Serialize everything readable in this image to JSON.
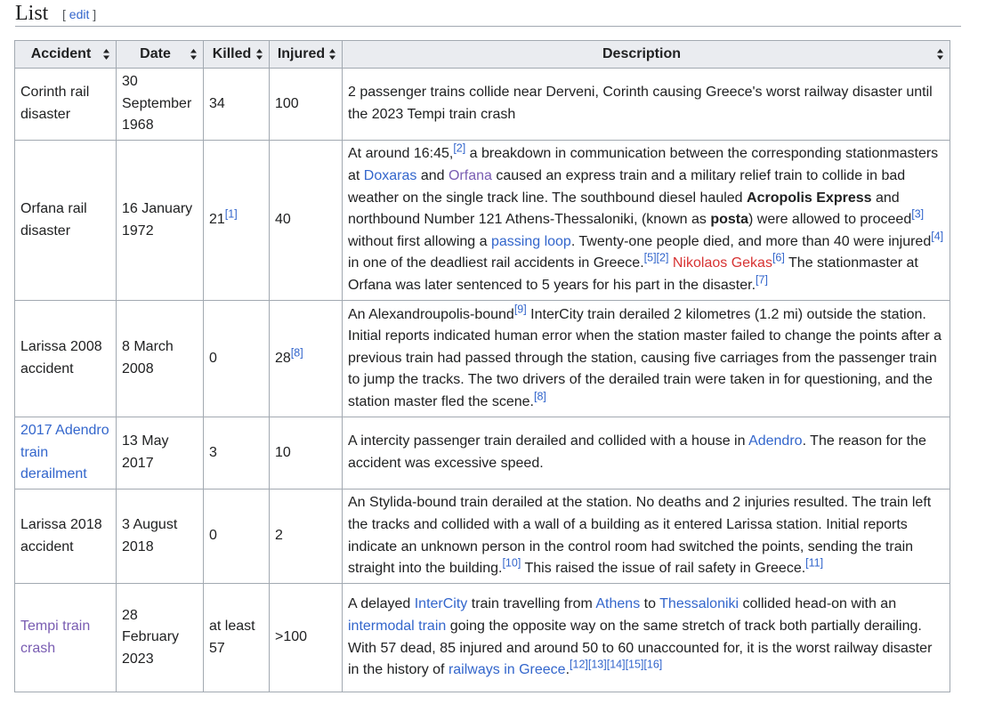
{
  "section": {
    "title": "List",
    "edit_open": "[",
    "edit_label": "edit",
    "edit_close": "]"
  },
  "headers": {
    "accident": "Accident",
    "date": "Date",
    "killed": "Killed",
    "injured": "Injured",
    "description": "Description"
  },
  "rows": [
    {
      "accident": "Corinth rail disaster",
      "date": "30 September 1968",
      "killed": "34",
      "injured": "100",
      "description": "2 passenger trains collide near Derveni, Corinth causing Greece's worst railway disaster until the 2023 Tempi train crash"
    },
    {
      "accident": "Orfana rail disaster",
      "date": "16 January 1972",
      "killed": "21",
      "killed_ref": "[1]",
      "injured": "40",
      "d": {
        "t1": "At around 16:45,",
        "r2": "[2]",
        "t2": " a breakdown in communication between the corresponding stationmasters at ",
        "l_doxaras": "Doxaras",
        "t3": " and ",
        "l_orfana": "Orfana",
        "t4": " caused an express train and a military relief train to collide in bad weather on the single track line. The southbound diesel hauled ",
        "b_acropolis": "Acropolis Express",
        "t5": " and northbound Number 121 Athens-Thessaloniki, (known as ",
        "b_posta": "posta",
        "t6": ") were allowed to proceed",
        "r3": "[3]",
        "t7": " without first allowing a ",
        "l_passing": "passing loop",
        "t8": ". Twenty-one people died, and more than 40 were injured",
        "r4": "[4]",
        "t9": " in one of the deadliest rail accidents in Greece.",
        "r5": "[5]",
        "r2b": "[2]",
        "t10": " ",
        "l_gekas": "Nikolaos Gekas",
        "r6": "[6]",
        "t11": " The stationmaster at Orfana was later sentenced to 5 years for his part in the disaster.",
        "r7": "[7]"
      }
    },
    {
      "accident": "Larissa 2008 accident",
      "date": "8 March 2008",
      "killed": "0",
      "injured": "28",
      "injured_ref": "[8]",
      "d": {
        "t1": "An Alexandroupolis-bound",
        "r9": "[9]",
        "t2": " InterCity train derailed 2 kilometres (1.2 mi) outside the station. Initial reports indicated human error when the station master failed to change the points after a previous train had passed through the station, causing five carriages from the passenger train to jump the tracks. The two drivers of the derailed train were taken in for questioning, and the station master fled the scene.",
        "r8": "[8]"
      }
    },
    {
      "accident": "2017 Adendro train derailment",
      "date": "13 May 2017",
      "killed": "3",
      "injured": "10",
      "d": {
        "t1": "A intercity passenger train derailed and collided with a house in ",
        "l_adendro": "Adendro",
        "t2": ". The reason for the accident was excessive speed."
      }
    },
    {
      "accident": "Larissa 2018 accident",
      "date": "3 August 2018",
      "killed": "0",
      "injured": "2",
      "d": {
        "t1": "An Stylida-bound train derailed at the station. No deaths and 2 injuries resulted. The train left the tracks and collided with a wall of a building as it entered Larissa station. Initial reports indicate an unknown person in the control room had switched the points, sending the train straight into the building.",
        "r10": "[10]",
        "t2": " This raised the issue of rail safety in Greece.",
        "r11": "[11]"
      }
    },
    {
      "accident": "Tempi train crash",
      "date": "28 February 2023",
      "killed": "at least 57",
      "injured": ">100",
      "d": {
        "t1": "A delayed ",
        "l_intercity": "InterCity",
        "t2": " train travelling from ",
        "l_athens": "Athens",
        "t3": " to ",
        "l_thessaloniki": "Thessaloniki",
        "t4": " collided head-on with an ",
        "l_intermodal": "intermodal train",
        "t5": " going the opposite way on the same stretch of track both partially derailing. With 57 dead, 85 injured and around 50 to 60 unaccounted for, it is the worst railway disaster in the history of ",
        "l_railways": "railways in Greece",
        "t6": ".",
        "refs": "[12][13][14][15][16]"
      }
    }
  ],
  "colors": {
    "link": "#3366cc",
    "visited_link": "#795cb2",
    "red_link": "#d73333",
    "header_bg": "#eaecf0",
    "border": "#a2a9b1"
  }
}
